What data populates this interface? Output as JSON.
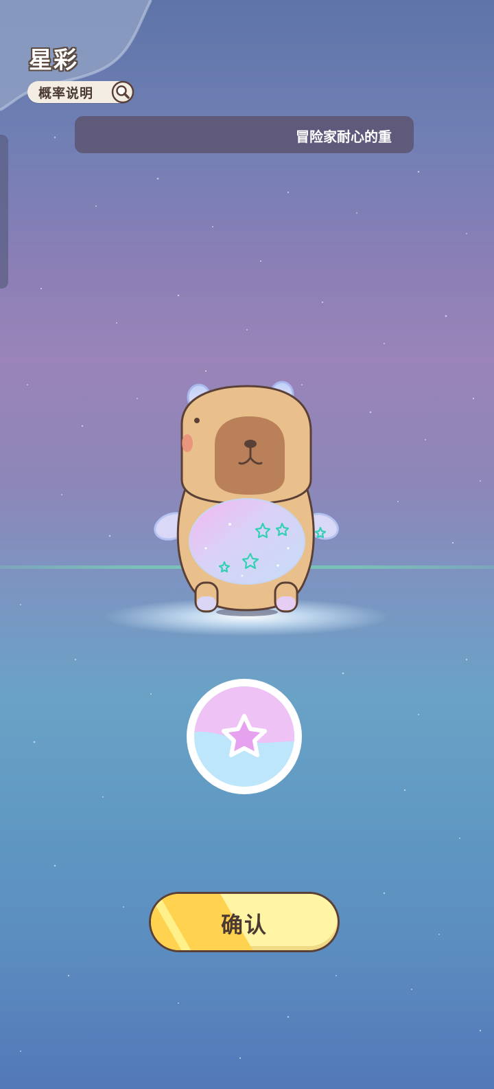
{
  "header": {
    "title": "星彩",
    "probability_button_label": "概率说明"
  },
  "ticker": {
    "text": "冒险家耐心的重"
  },
  "character": {
    "name": "capybara",
    "variant_icon": "star-icon"
  },
  "confirm": {
    "label": "确认"
  },
  "colors": {
    "badge_top": "#efc2f5",
    "badge_bottom": "#bde6fb",
    "button_fill": "#fff5a4",
    "button_stripe": "#ffd24f",
    "outline": "#5a4036"
  }
}
